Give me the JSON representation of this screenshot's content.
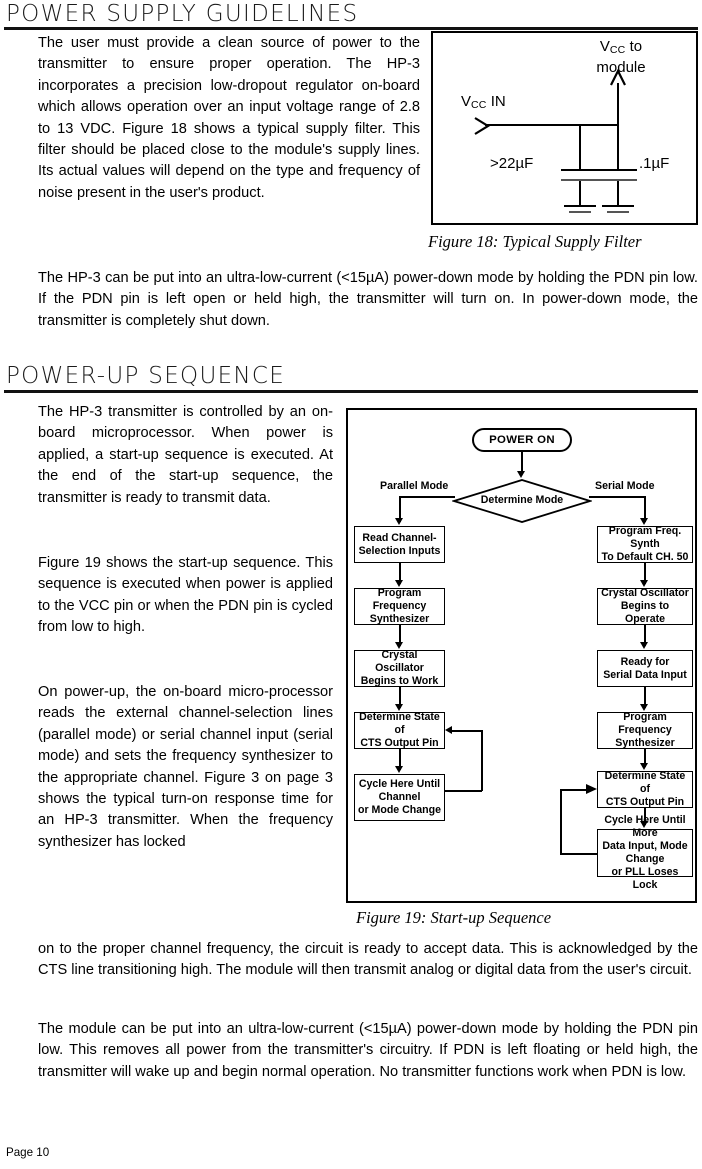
{
  "page": {
    "footer_label": "Page 10"
  },
  "sections": [
    {
      "heading": "POWER SUPPLY GUIDELINES",
      "paragraphs": [
        "The user must provide a clean source of power to the transmitter to ensure proper operation. The HP-3 incorporates a precision low-dropout regulator on-board which allows operation over an input voltage range of 2.8 to 13 VDC. Figure 18 shows a typical supply filter. This filter should be placed close to the module's supply lines. Its actual values will depend on the type and frequency of noise present in the user's product.",
        "The HP-3 can be put into an ultra-low-current (<15µA) power-down mode by holding the PDN pin low. If the PDN pin is left open or held high, the transmitter will turn on. In power-down mode, the transmitter is completely shut down."
      ]
    },
    {
      "heading": "POWER-UP SEQUENCE",
      "paragraphs": [
        "The HP-3 transmitter is controlled by an on-board microprocessor. When power is applied, a start-up sequence is executed. At the end of the start-up sequence, the transmitter is ready to transmit data.",
        "Figure 19 shows the start-up sequence. This sequence is executed when power is applied to the VCC pin or when the PDN pin is cycled from low to high.",
        "On power-up, the on-board micro-processor reads the external channel-selection lines (parallel mode) or serial channel input (serial mode) and sets the frequency synthesizer to the appropriate channel. Figure 3 on page 3 shows the typical turn-on response time for an HP-3 transmitter. When the frequency synthesizer has locked",
        "on to the proper channel frequency, the circuit is ready to accept data. This is acknowledged by the CTS line transitioning high. The module will then transmit analog or digital data from the user's circuit.",
        "The module can be put into an ultra-low-current (<15µA) power-down mode by holding the PDN pin low. This removes all power from the transmitter's circuitry. If PDN is left floating or held high, the transmitter will wake up and begin normal operation. No transmitter functions work when PDN is low."
      ]
    }
  ],
  "figure18": {
    "caption": "Figure 18: Typical Supply Filter",
    "input_label_main": "V",
    "input_label_sub": "CC",
    "input_label_tail": " IN",
    "output_label_line1_main": "V",
    "output_label_line1_sub": "CC",
    "output_label_line1_tail": " to",
    "output_label_line2": "module",
    "cap1_label": ">22µF",
    "cap2_label": ".1µF"
  },
  "figure19": {
    "caption": "Figure 19: Start-up Sequence",
    "terminator": "POWER ON",
    "decision": "Determine Mode",
    "branch_left_label": "Parallel Mode",
    "branch_right_label": "Serial Mode",
    "left_branch": [
      "Read Channel-\nSelection Inputs",
      "Program Frequency\nSynthesizer",
      "Crystal Oscillator\nBegins to Work",
      "Determine State of\nCTS Output Pin",
      "Cycle Here Until\nChannel\nor Mode Change"
    ],
    "right_branch": [
      "Program Freq. Synth\nTo Default CH. 50",
      "Crystal Oscillator\nBegins to Operate",
      "Ready for\nSerial Data Input",
      "Program Frequency\nSynthesizer",
      "Determine State of\nCTS Output Pin",
      "Cycle Here Until More\nData Input, Mode Change\nor PLL Loses Lock"
    ]
  },
  "colors": {
    "ink": "#000000",
    "heading_ink": "#1a1a1a",
    "paper": "#ffffff"
  }
}
